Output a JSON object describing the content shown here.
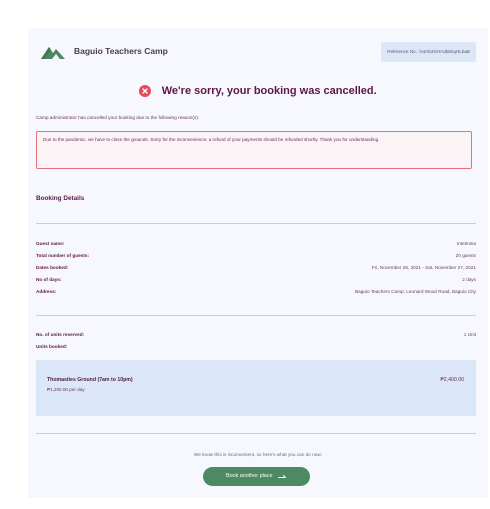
{
  "header": {
    "brand": "Baguio Teachers Camp",
    "reference": "Reference No.: lv4Ab3GHHJk8nqHLbaB"
  },
  "status": {
    "title": "We're sorry, your booking was cancelled.",
    "reason_label": "Camp administrator has cancelled your booking due to the following reason(s):",
    "reason": "Due to the pandemic, we have to close the grounds. Sorry for the inconvenience, a refund of your payments should be refunded shortly. Thank you for understanding."
  },
  "details": {
    "heading": "Booking Details",
    "rows": [
      {
        "label": "Guest name:",
        "value": "Intelmina"
      },
      {
        "label": "Total number of guests:",
        "value": "20 guests"
      },
      {
        "label": "Dates booked:",
        "value": "Fri, November 26, 2021 - Sat, November 27, 2021"
      },
      {
        "label": "No of days:",
        "value": "2 days"
      },
      {
        "label": "Address:",
        "value": "Baguio Teachers Camp, Leonard Wood Road, Baguio City"
      }
    ],
    "units_reserved_label": "No. of units reserved:",
    "units_reserved_value": "1 Unit",
    "units_booked_label": "Units booked:",
    "unit": {
      "name": "Thomasites Ground (7am to 10pm)",
      "rate": "₱1,200.00 per day",
      "price": "₱2,400.00"
    }
  },
  "footer": {
    "helper": "We know this is inconvenient, so here's what you can do now:",
    "cta_label": "Book another place",
    "cta_icon": "arrow-right-icon"
  },
  "colors": {
    "accent": "#4d8a63",
    "error": "#e64a5a",
    "title": "#5d1648",
    "unit_bg": "#dbe7f9"
  }
}
